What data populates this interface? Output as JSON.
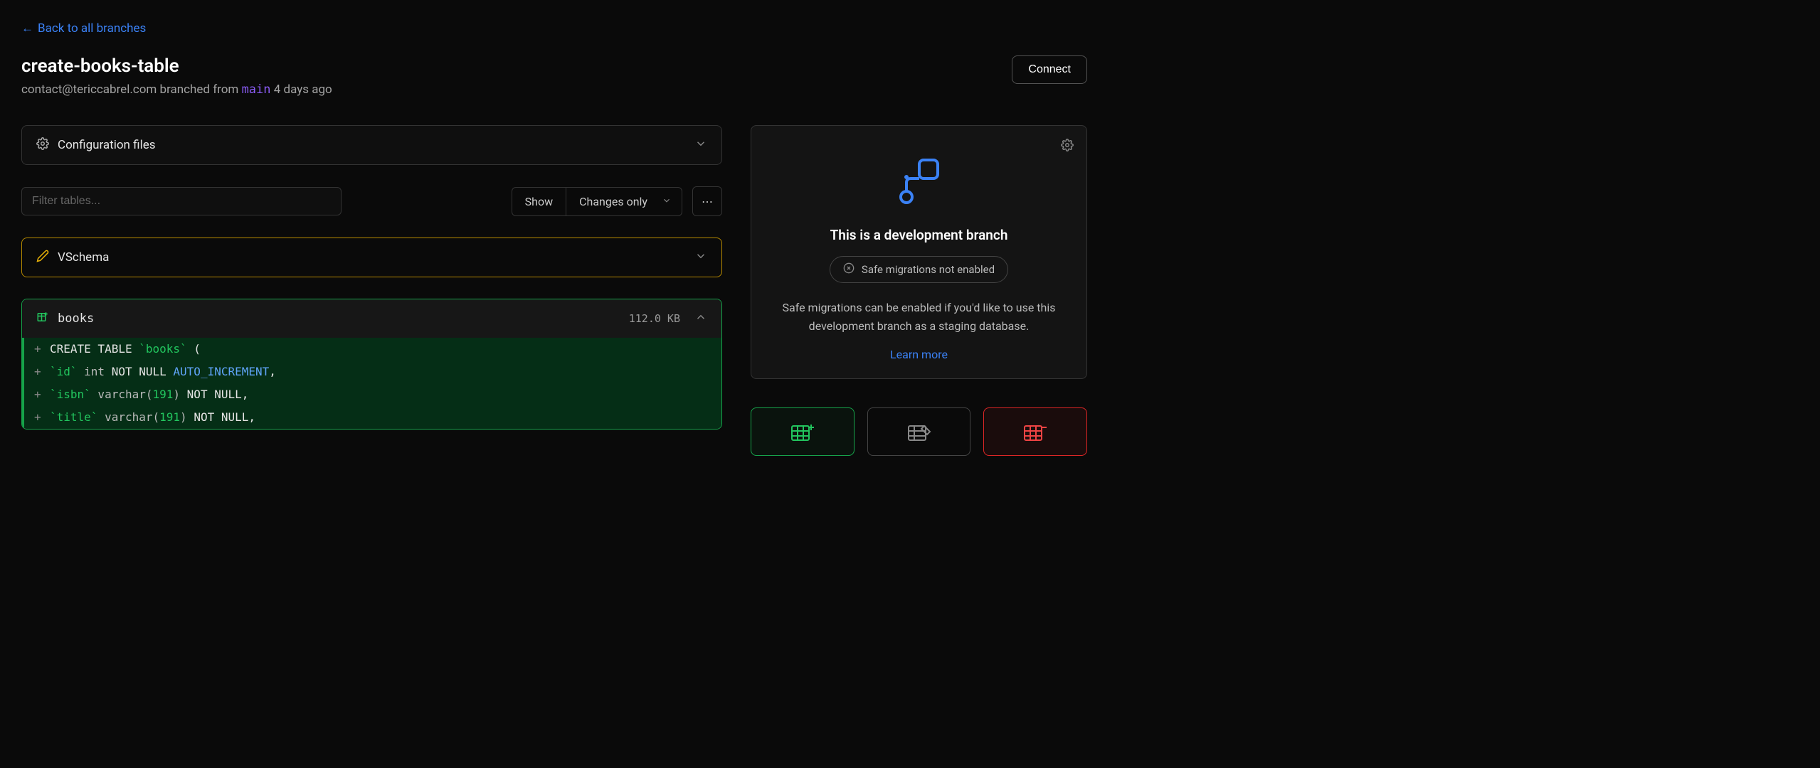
{
  "back_link": "Back to all branches",
  "branch": {
    "name": "create-books-table",
    "author": "contact@tericcabrel.com",
    "branched_from_text": "branched from",
    "parent": "main",
    "age": "4 days ago"
  },
  "connect_label": "Connect",
  "config_panel_title": "Configuration files",
  "filter_placeholder": "Filter tables...",
  "show_label": "Show",
  "show_selected": "Changes only",
  "vschema_title": "VSchema",
  "table": {
    "name": "books",
    "size": "112.0 KB"
  },
  "code_lines": [
    [
      {
        "t": "kw",
        "v": "CREATE TABLE "
      },
      {
        "t": "str",
        "v": "`books`"
      },
      {
        "t": "kw",
        "v": " ("
      }
    ],
    [
      {
        "t": "str",
        "v": "`id`"
      },
      {
        "t": "typ",
        "v": " int "
      },
      {
        "t": "cons",
        "v": "NOT NULL "
      },
      {
        "t": "func",
        "v": "AUTO_INCREMENT"
      },
      {
        "t": "kw",
        "v": ","
      }
    ],
    [
      {
        "t": "str",
        "v": "`isbn`"
      },
      {
        "t": "typ",
        "v": " varchar("
      },
      {
        "t": "num",
        "v": "191"
      },
      {
        "t": "typ",
        "v": ") "
      },
      {
        "t": "cons",
        "v": "NOT NULL"
      },
      {
        "t": "kw",
        "v": ","
      }
    ],
    [
      {
        "t": "str",
        "v": "`title`"
      },
      {
        "t": "typ",
        "v": " varchar("
      },
      {
        "t": "num",
        "v": "191"
      },
      {
        "t": "typ",
        "v": ") "
      },
      {
        "t": "cons",
        "v": "NOT NULL"
      },
      {
        "t": "kw",
        "v": ","
      }
    ]
  ],
  "dev_card": {
    "title": "This is a development branch",
    "pill": "Safe migrations not enabled",
    "desc": "Safe migrations can be enabled if you'd like to use this development branch as a staging database.",
    "learn_more": "Learn more"
  }
}
